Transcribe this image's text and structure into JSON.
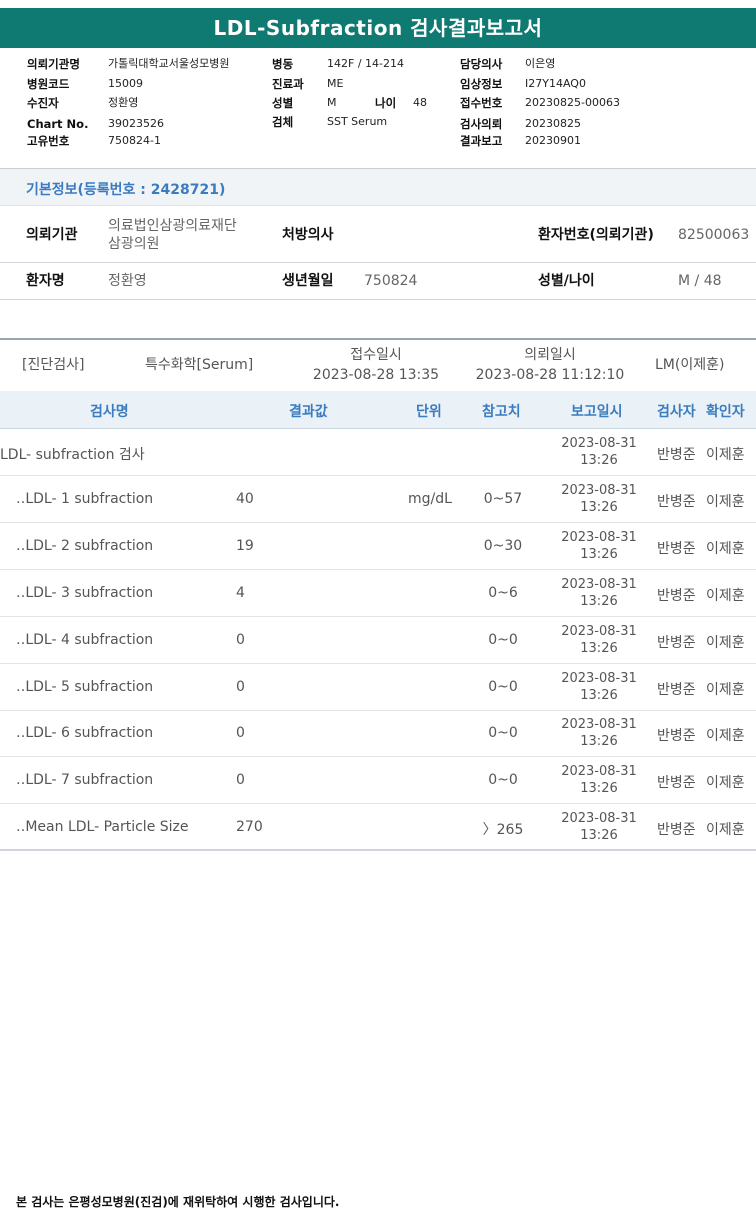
{
  "report_title": "LDL-Subfraction 검사결과보고서",
  "header": {
    "col1": [
      {
        "label": "의뢰기관명",
        "value": "가톨릭대학교서울성모병원"
      },
      {
        "label": "병원코드",
        "value": "15009"
      },
      {
        "label": "수진자",
        "value": "정환영"
      },
      {
        "label": "Chart No.",
        "value": "39023526"
      },
      {
        "label": "고유번호",
        "value": "750824-1"
      }
    ],
    "col2": [
      {
        "label": "병동",
        "value": "142F / 14-214"
      },
      {
        "label": "진료과",
        "value": "ME"
      },
      {
        "label": "성별",
        "value": "M"
      },
      {
        "label": "검체",
        "value": "SST Serum"
      }
    ],
    "age": {
      "label": "나이",
      "value": "48"
    },
    "col3": [
      {
        "label": "담당의사",
        "value": "이은영"
      },
      {
        "label": "임상정보",
        "value": "I27Y14AQ0"
      },
      {
        "label": "접수번호",
        "value": "20230825-00063"
      },
      {
        "label": "검사의뢰",
        "value": "20230825"
      },
      {
        "label": "결과보고",
        "value": "20230901"
      }
    ]
  },
  "basic_info": {
    "title": "기본정보(등록번호 : 2428721)",
    "institution_label": "의뢰기관",
    "institution_line1": "의료법인삼광의료재단",
    "institution_line2": "삼광의원",
    "doctor_label": "처방의사",
    "doctor_value": "",
    "patient_no_label": "환자번호(의뢰기관)",
    "patient_no_value": "82500063",
    "name_label": "환자명",
    "name_value": "정환영",
    "birth_label": "생년월일",
    "birth_value": "750824",
    "sex_age_label": "성별/나이",
    "sex_age_value": "M / 48"
  },
  "exam_info": {
    "category": "[진단검사]",
    "specimen": "특수화학[Serum]",
    "received_label": "접수일시",
    "received_value": "2023-08-28 13:35",
    "requested_label": "의뢰일시",
    "requested_value": "2023-08-28 11:12:10",
    "lm": "LM(이제훈)"
  },
  "table": {
    "headers": {
      "name": "검사명",
      "result": "결과값",
      "unit": "단위",
      "ref": "참고치",
      "report": "보고일시",
      "tester": "검사자",
      "confirmer": "확인자"
    },
    "rows": [
      {
        "name": "LDL- subfraction 검사",
        "result": "",
        "unit": "",
        "ref": "",
        "date": "2023-08-31",
        "time": "13:26",
        "tester": "반병준",
        "confirmer": "이제훈"
      },
      {
        "name": "‥LDL- 1 subfraction",
        "result": "40",
        "unit": "mg/dL",
        "ref": "0~57",
        "date": "2023-08-31",
        "time": "13:26",
        "tester": "반병준",
        "confirmer": "이제훈"
      },
      {
        "name": "‥LDL- 2 subfraction",
        "result": "19",
        "unit": "",
        "ref": "0~30",
        "date": "2023-08-31",
        "time": "13:26",
        "tester": "반병준",
        "confirmer": "이제훈"
      },
      {
        "name": "‥LDL- 3 subfraction",
        "result": "4",
        "unit": "",
        "ref": "0~6",
        "date": "2023-08-31",
        "time": "13:26",
        "tester": "반병준",
        "confirmer": "이제훈"
      },
      {
        "name": "‥LDL- 4 subfraction",
        "result": "0",
        "unit": "",
        "ref": "0~0",
        "date": "2023-08-31",
        "time": "13:26",
        "tester": "반병준",
        "confirmer": "이제훈"
      },
      {
        "name": "‥LDL- 5 subfraction",
        "result": "0",
        "unit": "",
        "ref": "0~0",
        "date": "2023-08-31",
        "time": "13:26",
        "tester": "반병준",
        "confirmer": "이제훈"
      },
      {
        "name": "‥LDL- 6 subfraction",
        "result": "0",
        "unit": "",
        "ref": "0~0",
        "date": "2023-08-31",
        "time": "13:26",
        "tester": "반병준",
        "confirmer": "이제훈"
      },
      {
        "name": "‥LDL- 7 subfraction",
        "result": "0",
        "unit": "",
        "ref": "0~0",
        "date": "2023-08-31",
        "time": "13:26",
        "tester": "반병준",
        "confirmer": "이제훈"
      },
      {
        "name": "‥Mean LDL- Particle Size",
        "result": "270",
        "unit": "",
        "ref": "〉265",
        "date": "2023-08-31",
        "time": "13:26",
        "tester": "반병준",
        "confirmer": "이제훈"
      }
    ]
  },
  "footer": "본 검사는 은평성모병원(진검)에 재위탁하여 시행한 검사입니다."
}
